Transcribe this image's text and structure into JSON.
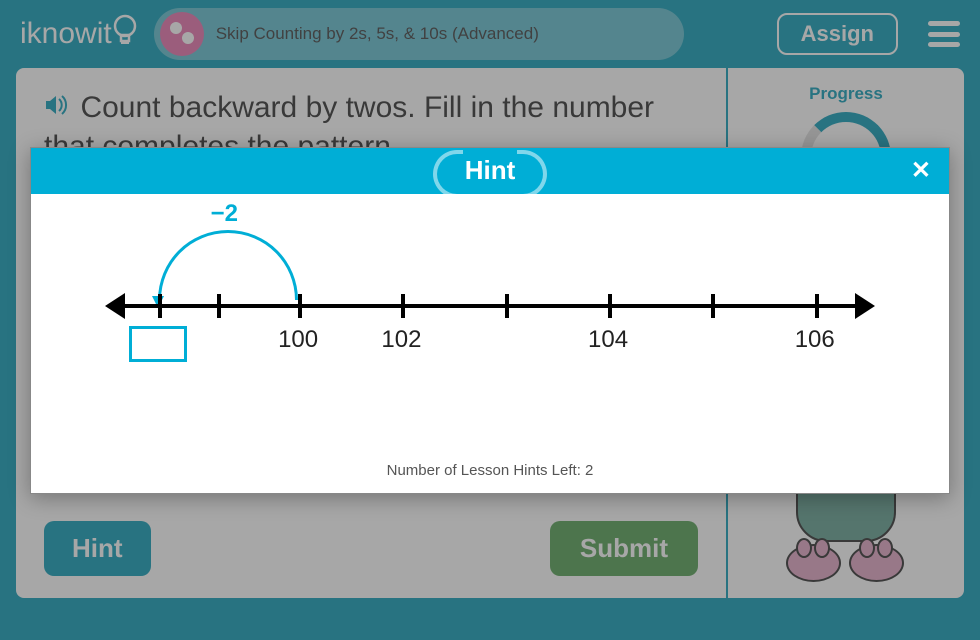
{
  "header": {
    "logo_text": "iknowit",
    "lesson_title": "Skip Counting by 2s, 5s, & 10s (Advanced)",
    "assign_label": "Assign"
  },
  "question": {
    "text": "Count backward by twos. Fill in the number that completes the pattern."
  },
  "buttons": {
    "hint": "Hint",
    "submit": "Submit"
  },
  "sidebar": {
    "progress_label": "Progress"
  },
  "modal": {
    "title": "Hint",
    "hints_left_text": "Number of Lesson Hints Left: 2",
    "arc_label": "−2",
    "ticks": [
      {
        "pos": 5,
        "label": "",
        "box": true
      },
      {
        "pos": 13,
        "label": ""
      },
      {
        "pos": 24,
        "label": "100"
      },
      {
        "pos": 38,
        "label": "102"
      },
      {
        "pos": 52,
        "label": ""
      },
      {
        "pos": 66,
        "label": "104"
      },
      {
        "pos": 80,
        "label": ""
      },
      {
        "pos": 94,
        "label": "106"
      }
    ]
  }
}
